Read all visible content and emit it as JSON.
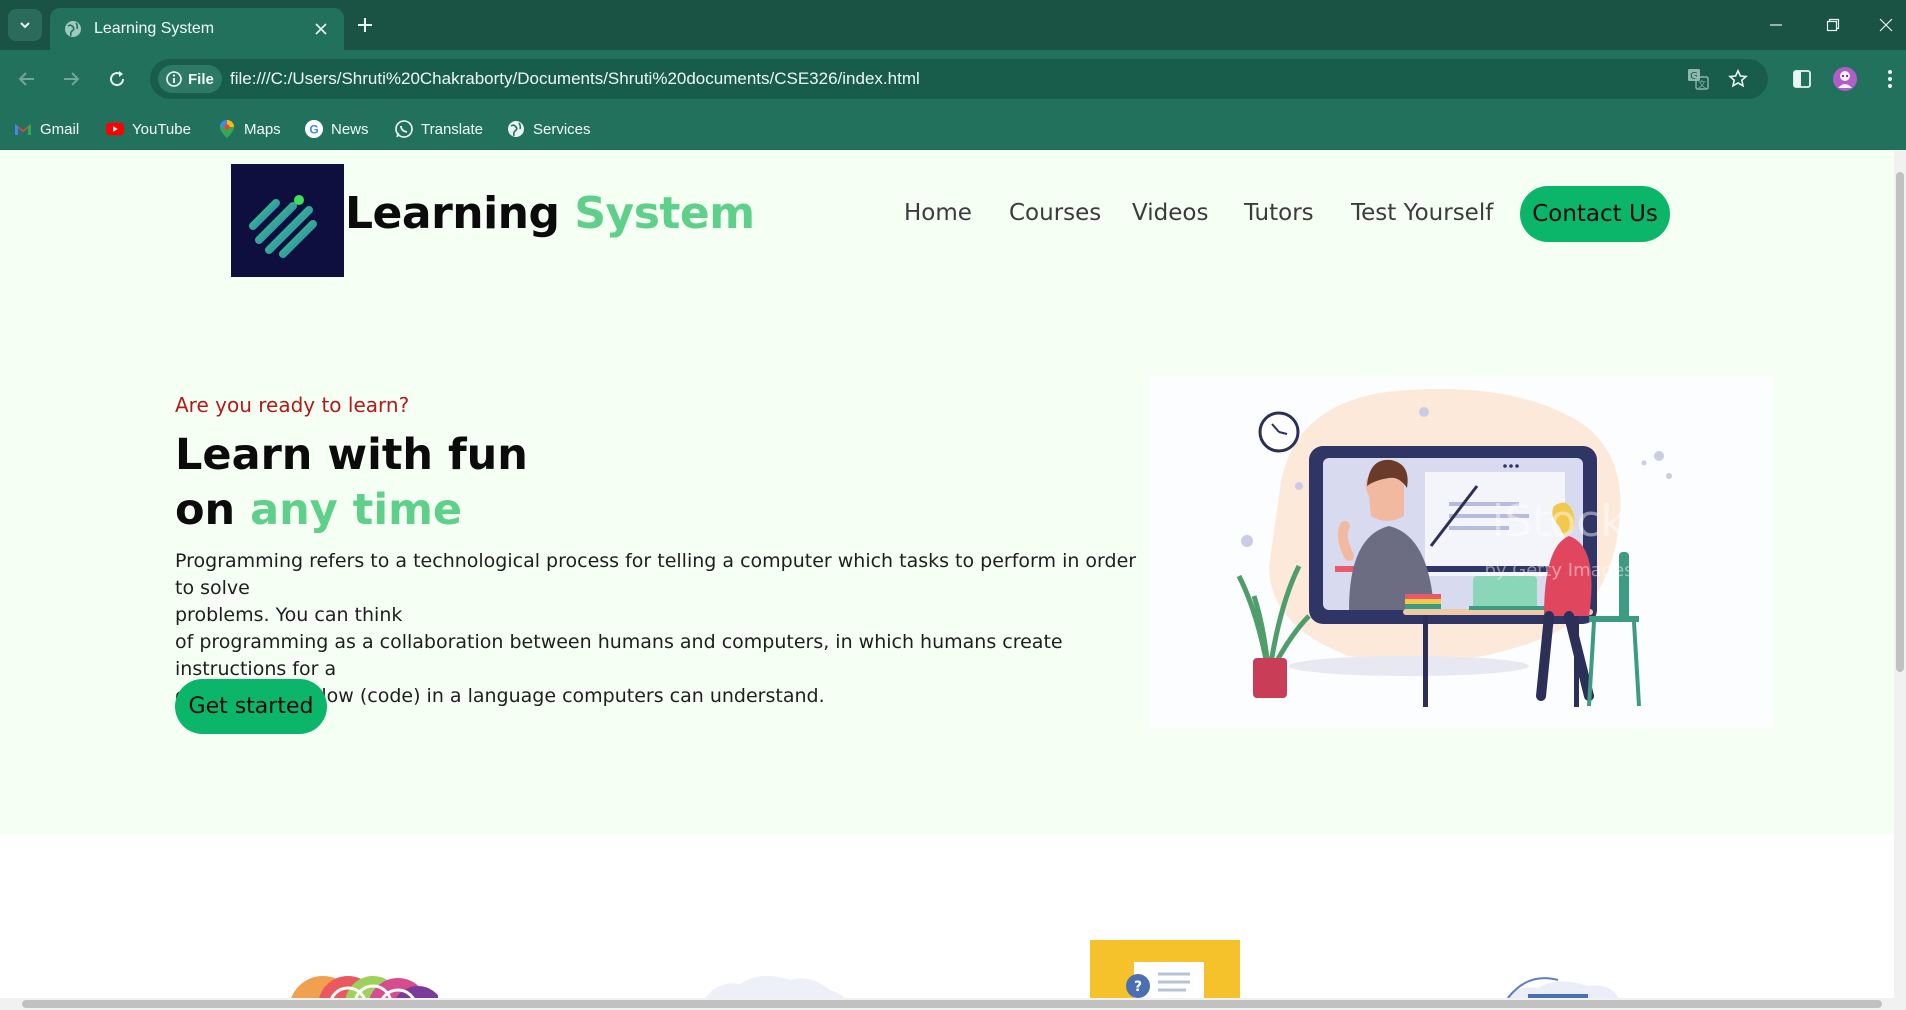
{
  "browser": {
    "tab": {
      "title": "Learning System"
    },
    "site_chip": "File",
    "url": "file:///C:/Users/Shruti%20Chakraborty/Documents/Shruti%20documents/CSE326/index.html",
    "bookmarks": [
      {
        "label": "Gmail",
        "icon": "gmail-icon"
      },
      {
        "label": "YouTube",
        "icon": "youtube-icon"
      },
      {
        "label": "Maps",
        "icon": "maps-icon"
      },
      {
        "label": "News",
        "icon": "google-news-icon"
      },
      {
        "label": "Translate",
        "icon": "whatsapp-icon"
      },
      {
        "label": "Services",
        "icon": "globe-icon"
      }
    ]
  },
  "header": {
    "brand_primary": "Learning",
    "brand_accent": "System",
    "nav": [
      "Home",
      "Courses",
      "Videos",
      "Tutors",
      "Test Yourself"
    ],
    "contact": "Contact Us"
  },
  "hero": {
    "eyebrow": "Are you ready to learn?",
    "headline_line1": "Learn with fun",
    "headline_on": "on",
    "headline_accent": "any time",
    "body_lines": [
      "Programming refers to a technological process for telling a computer which tasks to perform in order to solve",
      "problems. You can think",
      "of programming as a collaboration between humans and computers, in which humans create instructions for a",
      "computer to follow (code) in a language computers can understand."
    ],
    "cta": "Get started",
    "image_watermark": "iStock",
    "image_watermark_credit": "by Getty Images"
  },
  "colors": {
    "accent_green": "#5ed08a",
    "button_green": "#0bb56a",
    "eyebrow_red": "#b01b1b",
    "hero_bg": "#f5fff3",
    "chrome_dark": "#1a5244",
    "chrome": "#22715d"
  }
}
